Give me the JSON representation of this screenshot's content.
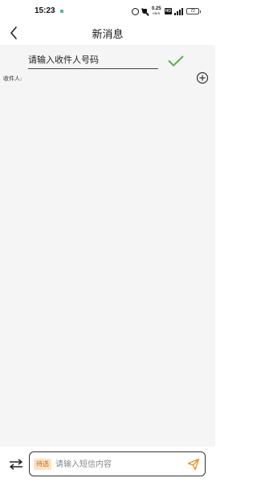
{
  "status_bar": {
    "time": "15:23",
    "net_speed": "0.25",
    "net_speed_unit": "KB/S",
    "hd_label": "HD",
    "battery": "72",
    "icons": [
      "alarm-icon",
      "mute-icon",
      "signal-icon",
      "battery-icon"
    ]
  },
  "header": {
    "title": "新消息",
    "back_icon": "chevron-left-icon"
  },
  "recipient": {
    "placeholder": "请输入收件人号码",
    "value": "",
    "confirm_icon": "check-icon",
    "label": "收件人:",
    "add_icon": "plus-circle-icon"
  },
  "compose": {
    "switch_icon": "swap-icon",
    "pending_badge": "待选",
    "placeholder": "请输入短信内容",
    "value": "",
    "send_icon": "send-icon"
  },
  "colors": {
    "confirm_green": "#56b34a",
    "send_orange": "#e8912a",
    "badge_bg": "#fde3c6",
    "badge_text": "#c4661a",
    "content_bg": "#f5f5f5"
  }
}
